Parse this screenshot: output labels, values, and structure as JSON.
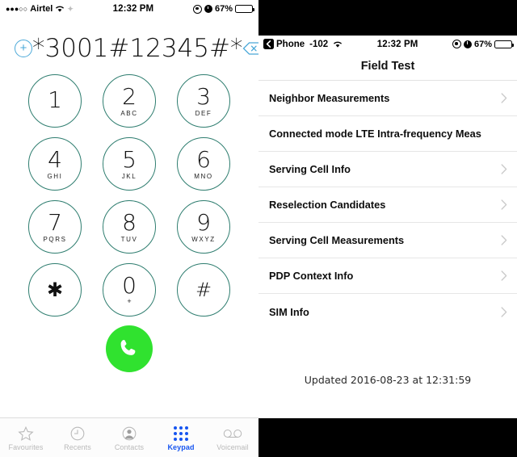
{
  "phone": {
    "statusbar": {
      "signal_dots": "●●●○○",
      "carrier": "Airtel",
      "wifi_icon": "wifi-icon",
      "sync_icon": "sync-icon",
      "time": "12:32 PM",
      "location_icon": "location-arrow-icon",
      "alarm_icon": "alarm-clock-icon",
      "battery_percent": "67%",
      "battery_level": 67
    },
    "dial": {
      "add_contact_icon": "plus-circle-icon",
      "number": "*3001#12345#*",
      "backspace_icon": "backspace-icon"
    },
    "keys": [
      {
        "digit": "1",
        "letters": ""
      },
      {
        "digit": "2",
        "letters": "ABC"
      },
      {
        "digit": "3",
        "letters": "DEF"
      },
      {
        "digit": "4",
        "letters": "GHI"
      },
      {
        "digit": "5",
        "letters": "JKL"
      },
      {
        "digit": "6",
        "letters": "MNO"
      },
      {
        "digit": "7",
        "letters": "PQRS"
      },
      {
        "digit": "8",
        "letters": "TUV"
      },
      {
        "digit": "9",
        "letters": "WXYZ"
      },
      {
        "digit": "✱",
        "letters": ""
      },
      {
        "digit": "0",
        "letters": "+"
      },
      {
        "digit": "#",
        "letters": ""
      }
    ],
    "call_button": {
      "icon": "phone-handset-icon",
      "color": "#30e22f"
    },
    "tabs": [
      {
        "label": "Favourites",
        "icon": "star-icon",
        "active": false
      },
      {
        "label": "Recents",
        "icon": "clock-icon",
        "active": false
      },
      {
        "label": "Contacts",
        "icon": "person-icon",
        "active": false
      },
      {
        "label": "Keypad",
        "icon": "keypad-dots-icon",
        "active": true
      },
      {
        "label": "Voicemail",
        "icon": "voicemail-icon",
        "active": false
      }
    ],
    "colors": {
      "key_border": "#2e7d6f",
      "accent_blue": "#4aa8d8",
      "tab_active": "#1554f0",
      "call_green": "#30e22f"
    }
  },
  "fieldtest": {
    "statusbar": {
      "back_icon": "chevron-left-icon",
      "back_label": "Phone",
      "signal_value": "-102",
      "wifi_icon": "wifi-icon",
      "time": "12:32 PM",
      "location_icon": "location-arrow-icon",
      "alarm_icon": "alarm-clock-icon",
      "battery_percent": "67%",
      "battery_level": 67
    },
    "title": "Field Test",
    "rows": [
      {
        "label": "Neighbor Measurements",
        "chevron": "chevron-right-icon"
      },
      {
        "label": "Connected mode LTE Intra-frequency Meas",
        "chevron": "chevron-right-icon"
      },
      {
        "label": "Serving Cell Info",
        "chevron": "chevron-right-icon"
      },
      {
        "label": "Reselection Candidates",
        "chevron": "chevron-right-icon"
      },
      {
        "label": "Serving Cell Measurements",
        "chevron": "chevron-right-icon"
      },
      {
        "label": "PDP Context Info",
        "chevron": "chevron-right-icon"
      },
      {
        "label": "SIM Info",
        "chevron": "chevron-right-icon"
      }
    ],
    "updated": "Updated 2016-08-23 at 12:31:59"
  }
}
